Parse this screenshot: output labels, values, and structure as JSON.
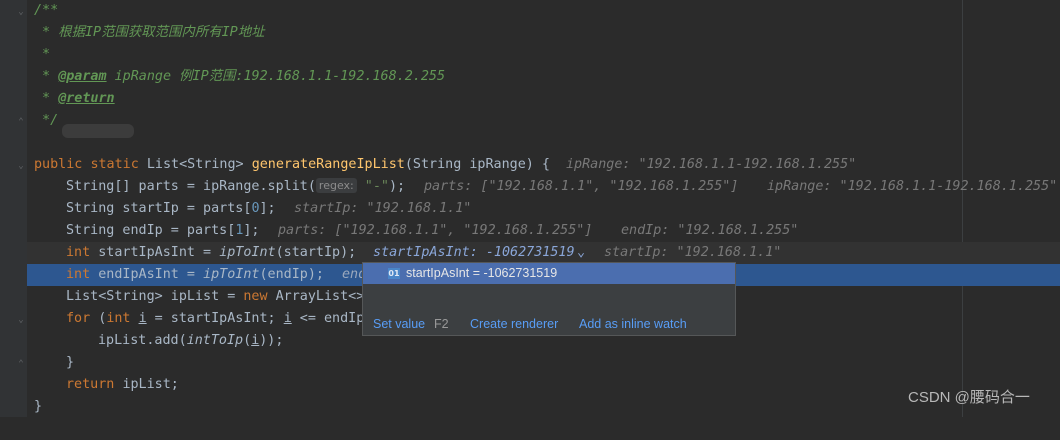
{
  "lines": {
    "l1": "/**",
    "l2": " * 根据IP范围获取范围内所有IP地址",
    "l3": " *",
    "l4a": " * ",
    "l4tag": "@param",
    "l4b": " ipRange 例IP范围:192.168.1.1-192.168.2.255",
    "l5a": " * ",
    "l5tag": "@return",
    "l6": " */",
    "l8": {
      "public": "public ",
      "static": "static ",
      "ret": "List<String> ",
      "method": "generateRangeIpList",
      "params": "(String ipRange) {",
      "inline": "ipRange: \"192.168.1.1-192.168.1.255\""
    },
    "l9": {
      "code_a": "String[] parts = ipRange.split(",
      "hint": "regex:",
      "str": " \"-\"",
      "code_b": ");",
      "inline1": "parts: [\"192.168.1.1\", \"192.168.1.255\"]",
      "inline2": "ipRange: \"192.168.1.1-192.168.1.255\""
    },
    "l10": {
      "code_a": "String startIp = parts[",
      "num": "0",
      "code_b": "];",
      "inline": "startIp: \"192.168.1.1\""
    },
    "l11": {
      "code_a": "String endIp = parts[",
      "num": "1",
      "code_b": "];",
      "inline1": "parts: [\"192.168.1.1\", \"192.168.1.255\"]",
      "inline2": "endIp: \"192.168.1.255\""
    },
    "l12": {
      "kw": "int ",
      "code_a": "startIpAsInt = ",
      "mth": "ipToInt",
      "code_b": "(startIp);",
      "inline1": "startIpAsInt: -1062731519",
      "chevron": "⌄",
      "inline2": "startIp: \"192.168.1.1\""
    },
    "l13": {
      "kw": "int ",
      "code_a": "endIpAsInt = ",
      "mth": "ipToInt",
      "code_b": "(endIp);",
      "inline": "end"
    },
    "l14": {
      "code_a": "List<String> ipList = ",
      "kw": "new ",
      "code_b": "ArrayList<>"
    },
    "l15": {
      "kw1": "for ",
      "p1": "(",
      "kw2": "int ",
      "var": "i",
      "code_a": " = startIpAsInt; ",
      "var2": "i",
      "code_b": " <= endIp"
    },
    "l16": {
      "code_a": "ipList.add(",
      "mth": "intToIp",
      "p": "(",
      "var": "i",
      "code_b": "));"
    },
    "l17": "}",
    "l18": {
      "kw": "return ",
      "code": "ipList;"
    },
    "l19": "}"
  },
  "popup": {
    "icon": "01",
    "item": "startIpAsInt = -1062731519",
    "set_value": "Set value",
    "set_value_shortcut": "F2",
    "create_renderer": "Create renderer",
    "add_inline_watch": "Add as inline watch"
  },
  "watermark": "CSDN @腰码合一"
}
